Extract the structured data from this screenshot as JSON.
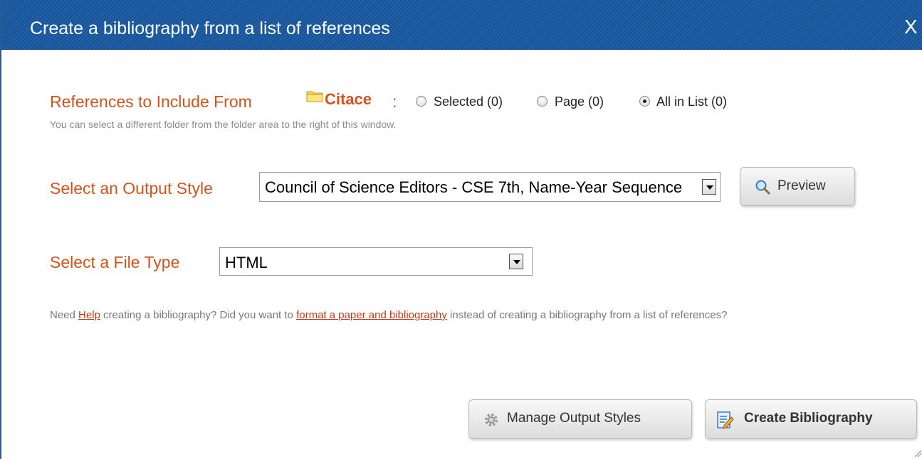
{
  "dialog": {
    "title": "Create a bibliography from a list of references",
    "close_label": "X"
  },
  "references": {
    "label": "References to Include From",
    "folder_name": "Citace",
    "colon": ":",
    "options": [
      {
        "label": "Selected (0)",
        "checked": false
      },
      {
        "label": "Page (0)",
        "checked": false
      },
      {
        "label": "All in List (0)",
        "checked": true
      }
    ],
    "hint": "You can select a different folder from the folder area to the right of this window."
  },
  "output_style": {
    "label": "Select an Output Style",
    "value": "Council of Science Editors - CSE 7th, Name-Year Sequence",
    "preview_label": "Preview"
  },
  "file_type": {
    "label": "Select a File Type",
    "value": "HTML"
  },
  "help": {
    "part1": "Need ",
    "help_link": "Help",
    "part2": " creating a bibliography? Did you want to ",
    "format_link": "format a paper and bibliography",
    "part3": " instead of creating a bibliography from a list of references?"
  },
  "buttons": {
    "manage_label": "Manage Output Styles",
    "create_label": "Create Bibliography"
  },
  "colors": {
    "title_bar": "#17569d",
    "label_orange": "#d2541b",
    "link_red": "#c0391b"
  },
  "icons": [
    "folder-icon",
    "magnifier-icon",
    "gear-icon",
    "edit-document-icon",
    "resize-grip-icon"
  ]
}
